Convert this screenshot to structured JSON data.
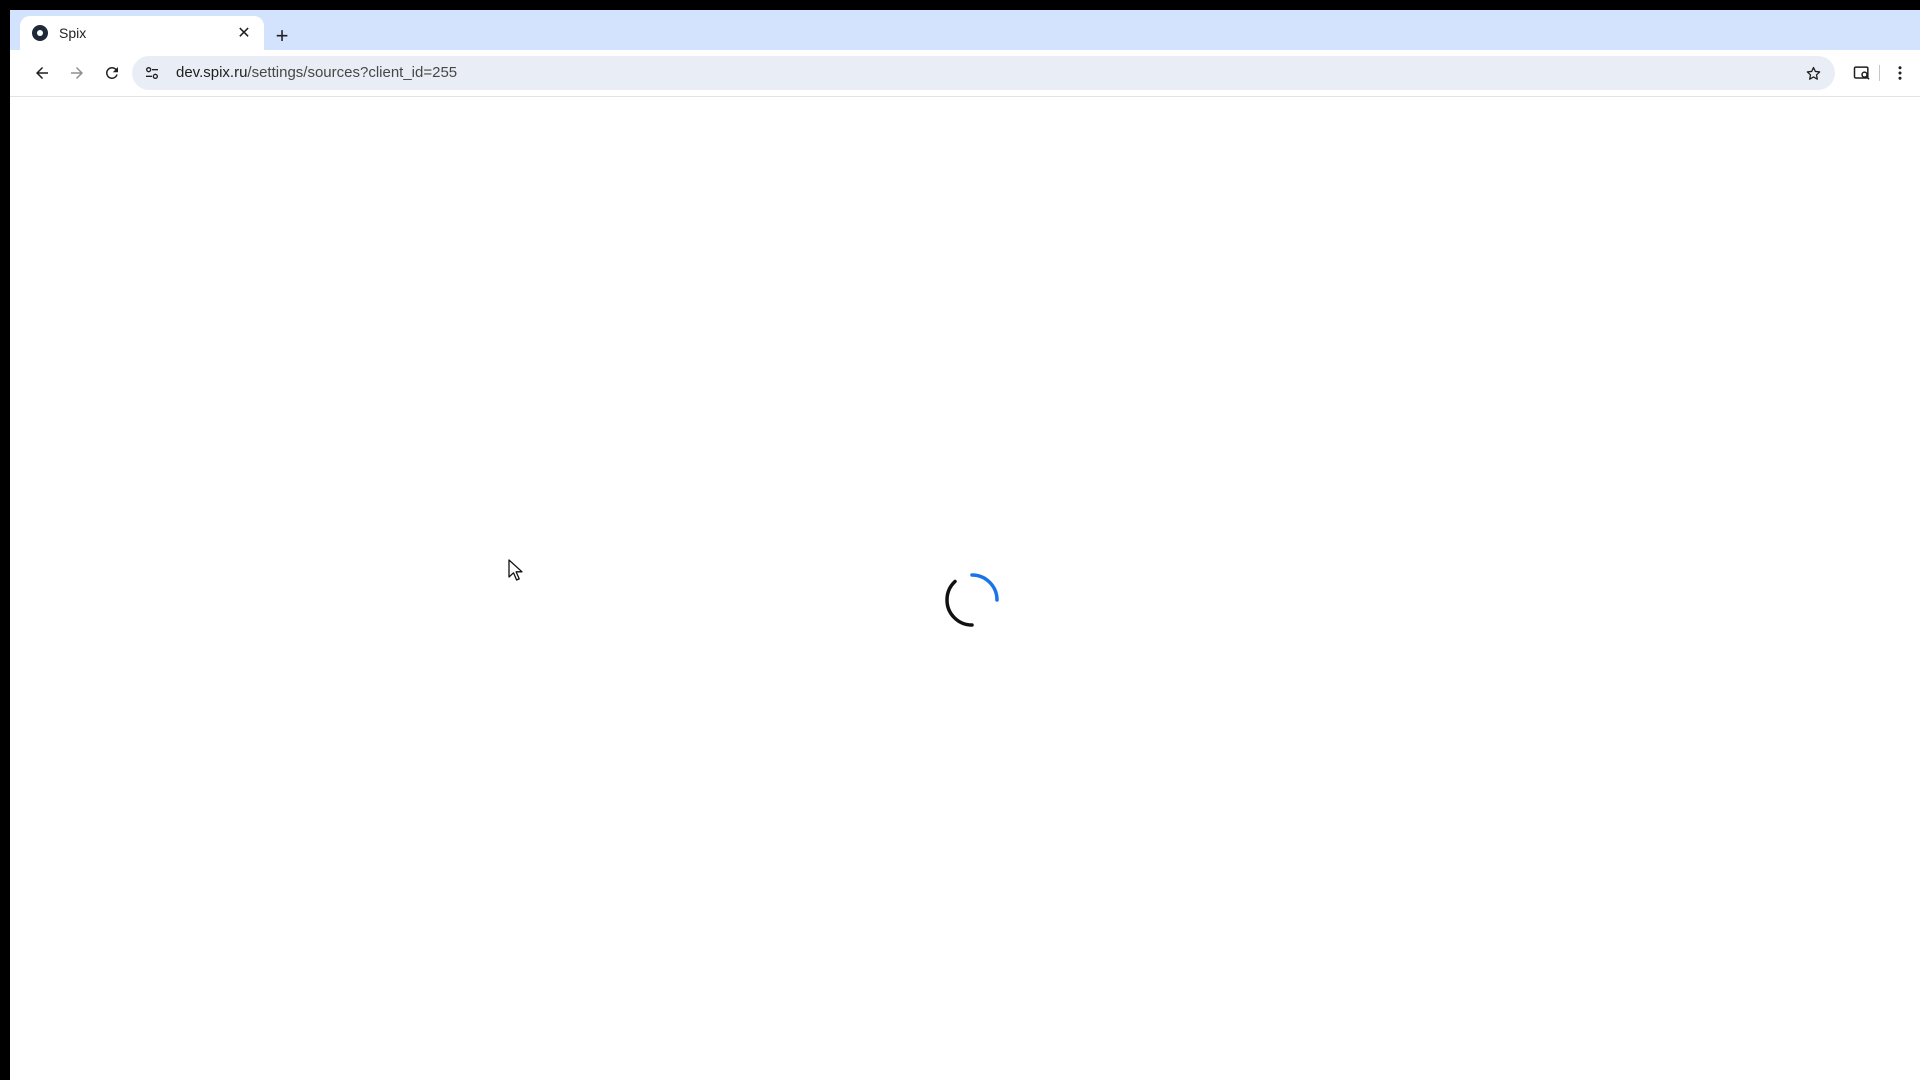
{
  "browser": {
    "tab": {
      "title": "Spix",
      "close_symbol": "✕",
      "favicon": "spix-logo-icon"
    },
    "new_tab_symbol": "+",
    "address_bar": {
      "host": "dev.spix.ru",
      "path": "/settings/sources?client_id=255"
    },
    "icons": {
      "back": "back-arrow-icon",
      "forward": "forward-arrow-icon",
      "reload": "reload-icon",
      "site_info": "tune-icon",
      "bookmark": "star-icon",
      "lens": "lens-search-icon",
      "menu": "kebab-menu-icon"
    }
  },
  "page": {
    "state": "loading",
    "spinner_colors": {
      "arc_primary": "#1a73e8",
      "arc_secondary": "#111111"
    }
  },
  "colors": {
    "tabstrip": "#d3e3fd",
    "omnibox": "#e9eef6",
    "frame": "#000000"
  }
}
